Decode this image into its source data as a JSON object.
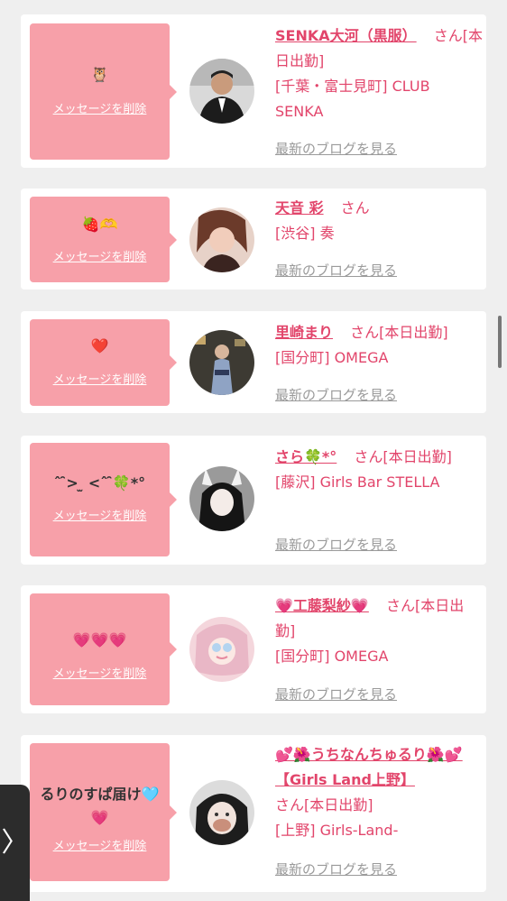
{
  "common": {
    "delete_label": "メッセージを削除",
    "blog_label": "最新のブログを見る",
    "san": "さん"
  },
  "cards": [
    {
      "message": "🦉",
      "name": "SENKA大河（黒服）",
      "status": "[本日出勤]",
      "store": "[千葉・富士見町] CLUB SENKA"
    },
    {
      "message": "🍓🫶",
      "name": "天音 彩",
      "status": "",
      "store": "[渋谷] 奏"
    },
    {
      "message": "❤️",
      "name": "里崎まり",
      "status": "[本日出勤]",
      "store": "[国分町] OMEGA"
    },
    {
      "message": "ˆ ̑̑>  ̫ <ˆ ̑̑🍀*°",
      "name": "さら🍀*°",
      "status": "[本日出勤]",
      "store": "[藤沢] Girls Bar STELLA"
    },
    {
      "message": "💗💗💗",
      "name": "💗工藤梨紗💗",
      "status": "[本日出勤]",
      "store": "[国分町] OMEGA"
    },
    {
      "message": "るりのすぱ届け🩵💗",
      "name": "💕🌺うちなんちゅるり🌺💕【Girls Land上野】",
      "status": "[本日出勤]",
      "store": "[上野] Girls-Land-"
    }
  ],
  "side_tab": {
    "label": "〉"
  }
}
